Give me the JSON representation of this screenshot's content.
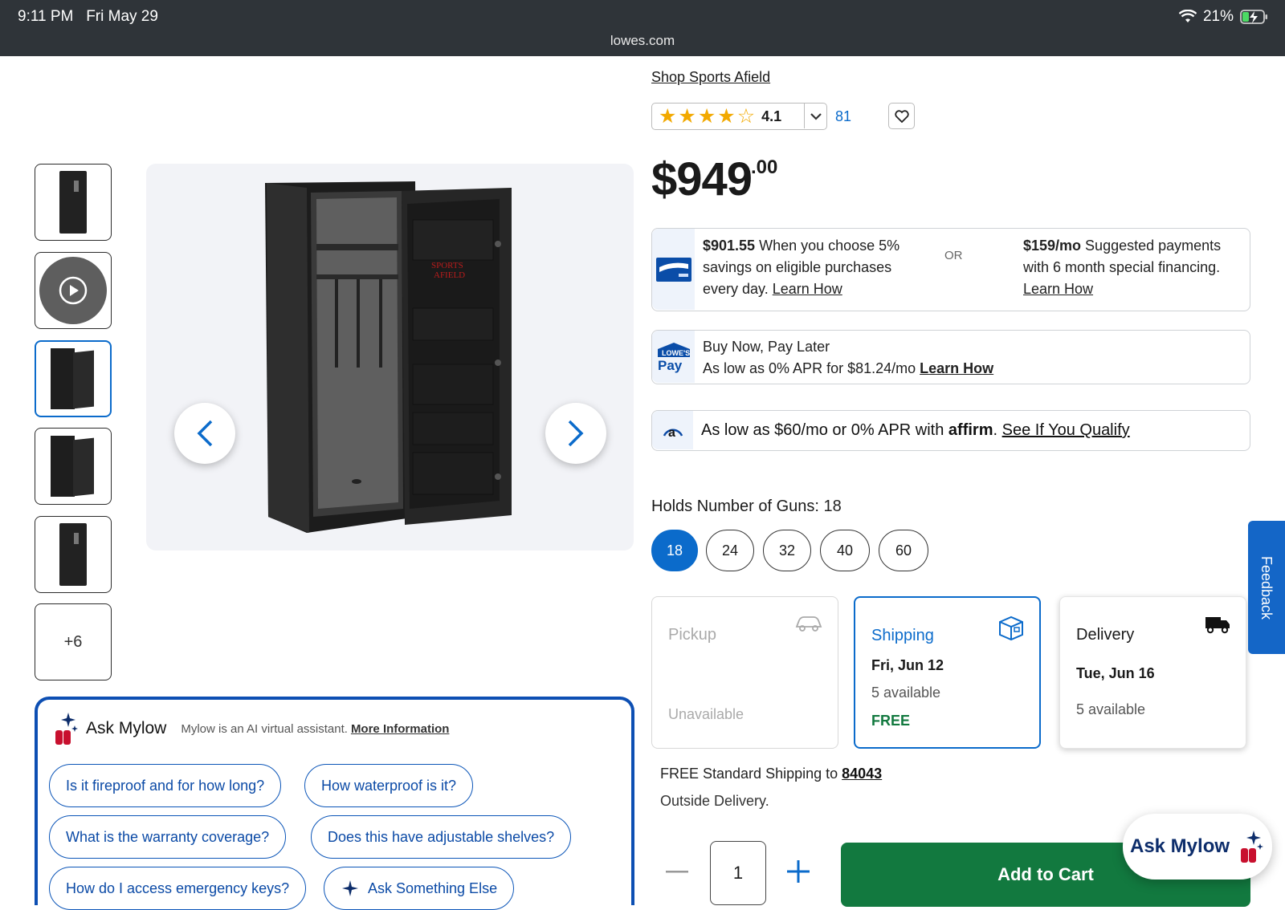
{
  "status_bar": {
    "time": "9:11 PM",
    "date": "Fri May 29",
    "url": "lowes.com",
    "battery": "21%"
  },
  "thumbnails": {
    "more_label": "+6"
  },
  "product": {
    "shop_link": "Shop Sports Afield",
    "rating": "4.1",
    "rating_stars": 4,
    "review_count": "81",
    "price_dollars": "$949",
    "price_cents": ".00"
  },
  "offers": {
    "card_savings_amount": "$901.55",
    "card_savings_text": " When you choose 5% savings on eligible purchases every day. ",
    "learn_how": "Learn How",
    "or": "OR",
    "financing_amount": "$159/mo",
    "financing_text": " Suggested payments with 6 month special financing.",
    "pay_title": "Buy Now, Pay Later",
    "pay_text": "As low as 0% APR for $81.24/mo ",
    "affirm_text": "As low as $60/mo or 0% APR with ",
    "affirm_brand": "affirm",
    "affirm_link": "See If You Qualify"
  },
  "holds": {
    "label": "Holds Number of Guns:",
    "value": "18",
    "options": [
      "18",
      "24",
      "32",
      "40",
      "60"
    ]
  },
  "fulfillment": {
    "pickup": {
      "title": "Pickup",
      "status": "Unavailable"
    },
    "shipping": {
      "title": "Shipping",
      "date": "Fri, Jun 12",
      "avail": "5 available",
      "price": "FREE"
    },
    "delivery": {
      "title": "Delivery",
      "date": "Tue, Jun 16",
      "avail": "5 available"
    }
  },
  "shipping_info": {
    "text": "FREE Standard Shipping to ",
    "zip": "84043",
    "outside": "Outside Delivery."
  },
  "cart": {
    "qty": "1",
    "add_label": "Add to Cart"
  },
  "mylow": {
    "title": "Ask Mylow",
    "subtitle": "Mylow is an AI virtual assistant.",
    "more_info": "More Information",
    "chips": [
      "Is it fireproof and for how long?",
      "How waterproof is it?",
      "What is the warranty coverage?",
      "Does this have adjustable shelves?",
      "How do I access emergency keys?",
      "Ask Something Else"
    ]
  },
  "float_button": "Ask Mylow",
  "feedback": "Feedback",
  "colors": {
    "lowes_blue": "#0b6bcb",
    "cart_green": "#12793f",
    "star": "#f2a900"
  }
}
